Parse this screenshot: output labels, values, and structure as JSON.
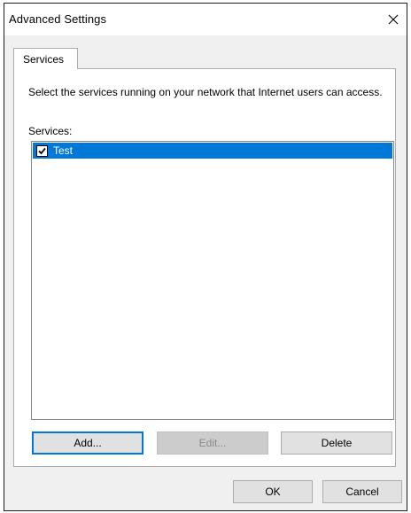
{
  "window": {
    "title": "Advanced Settings",
    "close_icon": "close-icon"
  },
  "tabs": [
    {
      "label": "Services",
      "selected": true
    }
  ],
  "panel": {
    "description": "Select the services running on your network that Internet users can access.",
    "services_label": "Services:",
    "services": [
      {
        "label": "Test",
        "checked": true,
        "selected": true
      }
    ],
    "buttons": {
      "add": "Add...",
      "edit": "Edit...",
      "delete": "Delete"
    }
  },
  "footer": {
    "ok": "OK",
    "cancel": "Cancel"
  },
  "colors": {
    "selection": "#0078d7",
    "window_bg": "#f0f0f0",
    "panel_bg": "#ffffff"
  }
}
